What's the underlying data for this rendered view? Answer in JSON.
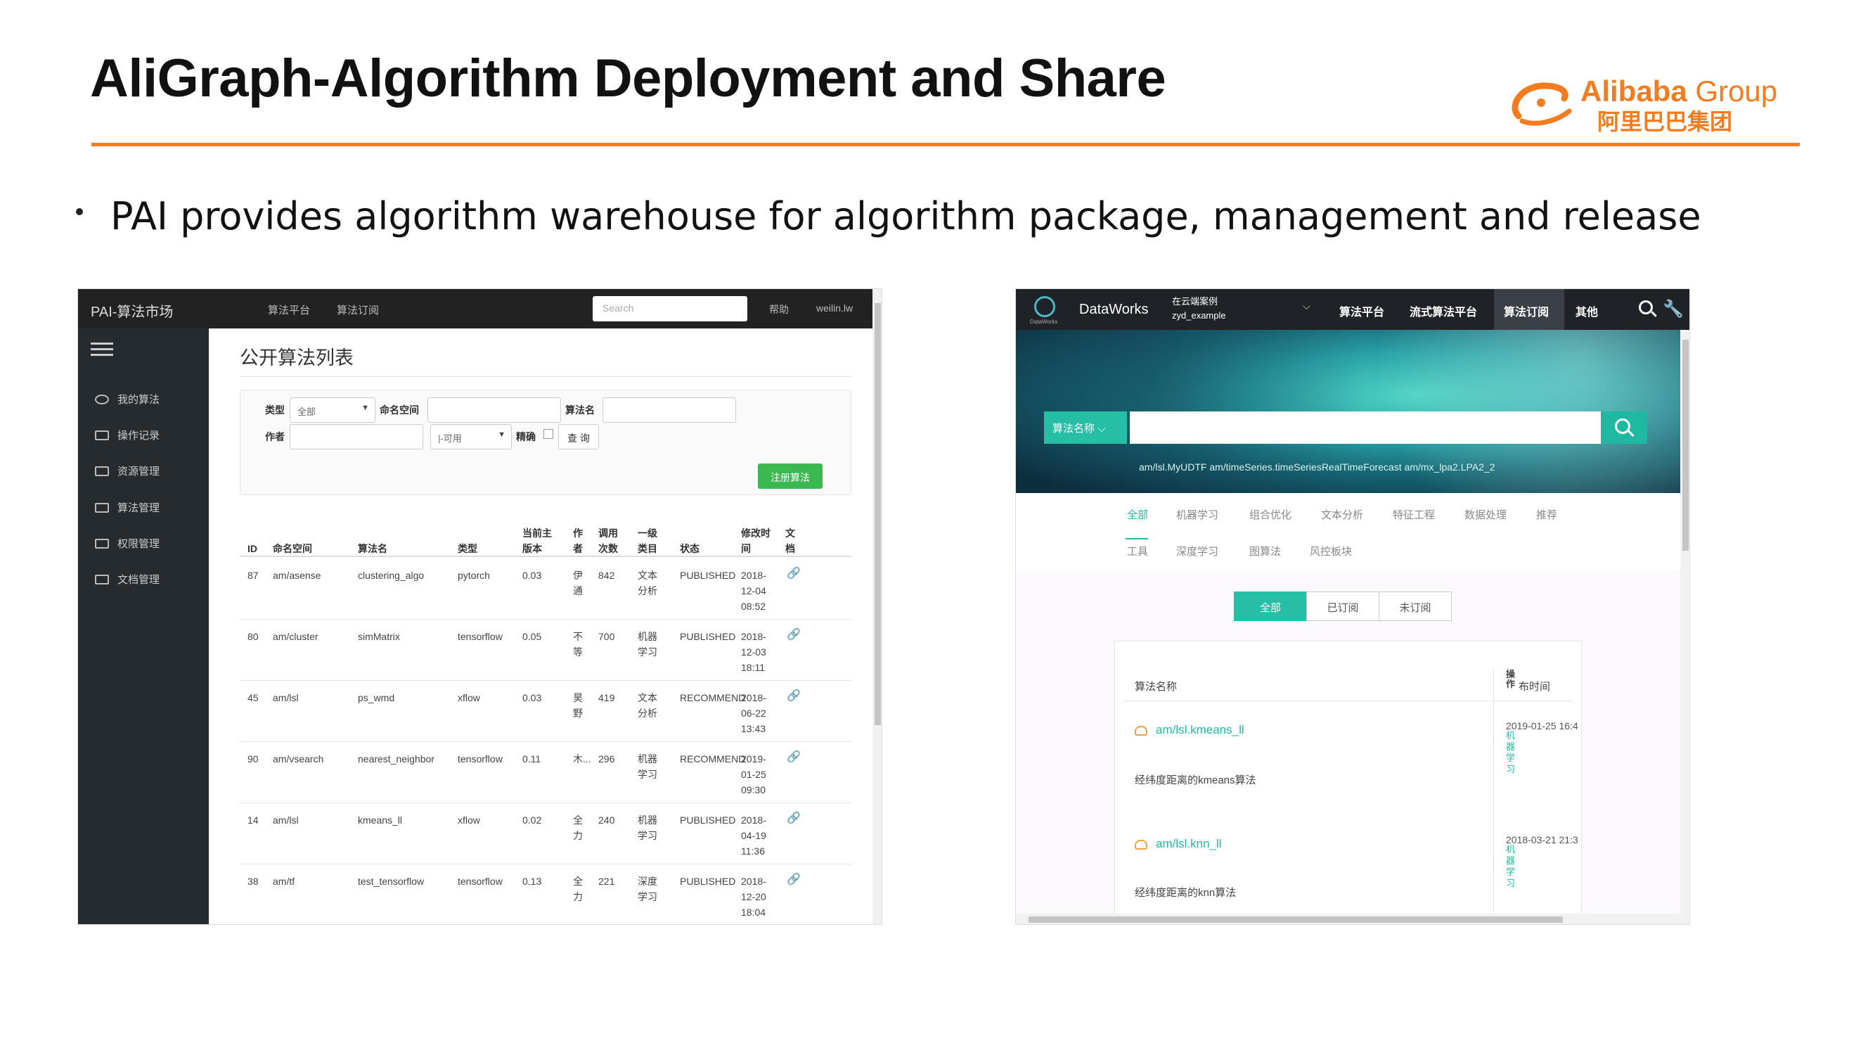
{
  "slide": {
    "title": "AliGraph-Algorithm Deployment and Share",
    "bullet": "PAI provides algorithm warehouse for algorithm package, management and release",
    "accent_color": "#f47c20",
    "logo": {
      "en_bold": "Alibaba",
      "en_light": "Group",
      "cn": "阿里巴巴集团"
    }
  },
  "left_app": {
    "brand": "PAI-算法市场",
    "nav": [
      "算法平台",
      "算法订阅"
    ],
    "search_placeholder": "Search",
    "help": "帮助",
    "user": "weilin.lw",
    "sidebar": [
      "我的算法",
      "操作记录",
      "资源管理",
      "算法管理",
      "权限管理",
      "文档管理"
    ],
    "page_title": "公开算法列表",
    "filters": {
      "type_label": "类型",
      "type_value": "全部",
      "namespace_label": "命名空间",
      "algo_name_label": "算法名",
      "author_label": "作者",
      "avail_value": "|-可用",
      "exact_label": "精确",
      "query_button": "查 询",
      "register_button": "注册算法"
    },
    "table": {
      "headers": [
        "ID",
        "命名空间",
        "算法名",
        "类型",
        "当前主版本",
        "作者",
        "调用次数",
        "一级类目",
        "状态",
        "修改时间",
        "文档"
      ],
      "rows": [
        {
          "id": "87",
          "ns": "am/asense",
          "name": "clustering_algo",
          "type": "pytorch",
          "ver": "0.03",
          "author": "伊通",
          "calls": "842",
          "cat": "文本分析",
          "status": "PUBLISHED",
          "time": [
            "2018-",
            "12-04",
            "08:52"
          ]
        },
        {
          "id": "80",
          "ns": "am/cluster",
          "name": "simMatrix",
          "type": "tensorflow",
          "ver": "0.05",
          "author": "不等",
          "calls": "700",
          "cat": "机器学习",
          "status": "PUBLISHED",
          "time": [
            "2018-",
            "12-03",
            "18:11"
          ]
        },
        {
          "id": "45",
          "ns": "am/lsl",
          "name": "ps_wmd",
          "type": "xflow",
          "ver": "0.03",
          "author": "昊野",
          "calls": "419",
          "cat": "文本分析",
          "status": "RECOMMEND",
          "time": [
            "2018-",
            "06-22",
            "13:43"
          ]
        },
        {
          "id": "90",
          "ns": "am/vsearch",
          "name": "nearest_neighbor",
          "type": "tensorflow",
          "ver": "0.11",
          "author": "木...",
          "calls": "296",
          "cat": "机器学习",
          "status": "RECOMMEND",
          "time": [
            "2019-",
            "01-25",
            "09:30"
          ]
        },
        {
          "id": "14",
          "ns": "am/lsl",
          "name": "kmeans_ll",
          "type": "xflow",
          "ver": "0.02",
          "author": "全力",
          "calls": "240",
          "cat": "机器学习",
          "status": "PUBLISHED",
          "time": [
            "2018-",
            "04-19",
            "11:36"
          ]
        },
        {
          "id": "38",
          "ns": "am/tf",
          "name": "test_tensorflow",
          "type": "tensorflow",
          "ver": "0.13",
          "author": "全力",
          "calls": "221",
          "cat": "深度学习",
          "status": "PUBLISHED",
          "time": [
            "2018-",
            "12-20",
            "18:04"
          ]
        }
      ]
    }
  },
  "right_app": {
    "brand": "DataWorks",
    "logo_caption": "DataWorks",
    "project_line1": "在云端案例",
    "project_line2": "zyd_example",
    "nav": [
      "算法平台",
      "流式算法平台",
      "算法订阅",
      "其他"
    ],
    "search_select": "算法名称",
    "hot_terms": "am/lsl.MyUDTF  am/timeSeries.timeSeriesRealTimeForecast  am/mx_lpa2.LPA2_2",
    "categories_row1": [
      "全部",
      "机器学习",
      "组合优化",
      "文本分析",
      "特征工程",
      "数据处理",
      "推荐"
    ],
    "categories_row2": [
      "工具",
      "深度学习",
      "图算法",
      "风控板块"
    ],
    "segments": [
      "全部",
      "已订阅",
      "未订阅"
    ],
    "list_headers": {
      "name": "算法名称",
      "time": "布时间",
      "time_stack": "操作"
    },
    "items": [
      {
        "name": "am/lsl.kmeans_ll",
        "desc": "经纬度距离的kmeans算法",
        "date": "2019-01-25 16:4",
        "sub": "机器学习"
      },
      {
        "name": "am/lsl.knn_ll",
        "desc": "经纬度距离的knn算法",
        "date": "2018-03-21 21:3",
        "sub": "机器学习"
      }
    ]
  }
}
